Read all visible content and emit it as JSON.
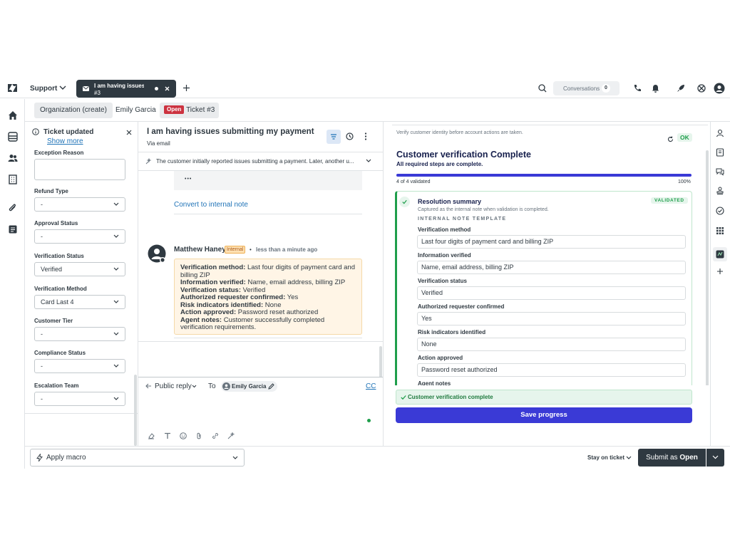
{
  "topbar": {
    "product": "Support",
    "app_tab": {
      "title": "I am having issues s...",
      "subtitle": "#3"
    },
    "conversations_label": "Conversations",
    "conversations_count": "0"
  },
  "tabs": {
    "org": "Organization (create)",
    "requester": "Emily Garcia",
    "status_badge": "Open",
    "ticket": "Ticket #3"
  },
  "notice": {
    "title": "Ticket updated",
    "link": "Show more"
  },
  "fields": [
    {
      "label": "Exception Reason",
      "value": ""
    },
    {
      "label": "Refund Type",
      "value": "-"
    },
    {
      "label": "Approval Status",
      "value": "-"
    },
    {
      "label": "Verification Status",
      "value": "Verified"
    },
    {
      "label": "Verification Method",
      "value": "Card Last 4"
    },
    {
      "label": "Customer Tier",
      "value": "-"
    },
    {
      "label": "Compliance Status",
      "value": "-"
    },
    {
      "label": "Escalation Team",
      "value": "-"
    }
  ],
  "ticket": {
    "subject": "I am having issues submitting my payment",
    "via": "Via email",
    "summary": "The customer initially reported issues submitting a payment. Later, another u..."
  },
  "conversation": {
    "ellipsis": "•••",
    "convert_link": "Convert to internal note",
    "author": "Matthew Haney",
    "internal_badge": "Internal",
    "time": "less than a minute ago",
    "note": [
      {
        "k": "Verification method:",
        "v": " Last four digits of payment card and billing ZIP"
      },
      {
        "k": "Information verified:",
        "v": " Name, email address, billing ZIP"
      },
      {
        "k": "Verification status:",
        "v": " Verified"
      },
      {
        "k": "Authorized requester confirmed:",
        "v": " Yes"
      },
      {
        "k": "Risk indicators identified:",
        "v": " None"
      },
      {
        "k": "Action approved:",
        "v": " Password reset authorized"
      },
      {
        "k": "Agent notes:",
        "v": " Customer successfully completed verification requirements."
      }
    ]
  },
  "composer": {
    "reply_type": "Public reply",
    "to_label": "To",
    "recipient": "Emily Garcia",
    "cc": "CC"
  },
  "app": {
    "hint": "Verify customer identity before account actions are taken.",
    "ok": "OK",
    "title": "Customer verification Complete",
    "subtitle": "All required steps are complete.",
    "progress_fraction": 1.0,
    "progress_label": "4 of 4 validated",
    "progress_pct": "100%",
    "resolution_title": "Resolution summary",
    "resolution_sub": "Captured as the internal note when validation is completed.",
    "validated_badge": "VALIDATED",
    "template_label": "INTERNAL NOTE TEMPLATE",
    "rows": [
      {
        "label": "Verification method",
        "value": "Last four digits of payment card and billing ZIP"
      },
      {
        "label": "Information verified",
        "value": "Name, email address, billing ZIP"
      },
      {
        "label": "Verification status",
        "value": "Verified"
      },
      {
        "label": "Authorized requester confirmed",
        "value": "Yes"
      },
      {
        "label": "Risk indicators identified",
        "value": "None"
      },
      {
        "label": "Action approved",
        "value": "Password reset authorized"
      }
    ],
    "agent_notes_label": "Agent notes",
    "complete_banner": "Customer verification complete",
    "save_button": "Save progress",
    "accent": "#3a3ad6",
    "success": "#1f9e4b"
  },
  "bottom": {
    "macro": "Apply macro",
    "stay": "Stay on ticket",
    "submit_prefix": "Submit as ",
    "submit_status": "Open"
  }
}
